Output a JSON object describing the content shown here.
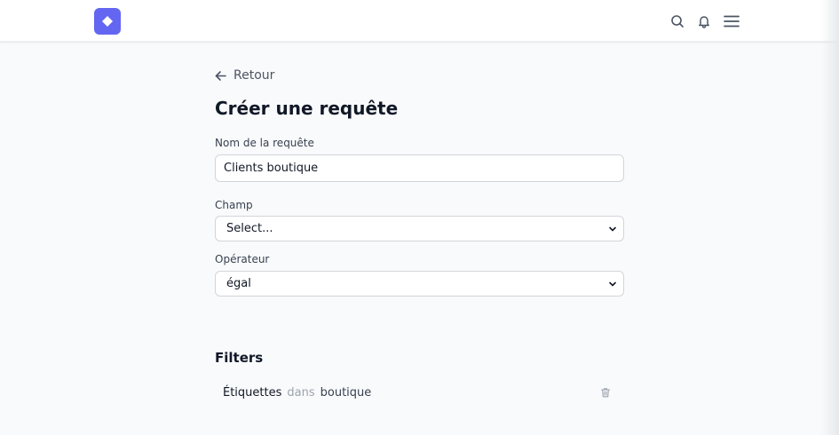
{
  "header": {
    "icons": [
      "logo-icon",
      "search-icon",
      "bell-icon",
      "menu-icon"
    ],
    "accent_color": "#6366f1"
  },
  "nav": {
    "back_label": "Retour"
  },
  "page": {
    "title": "Créer une requête"
  },
  "form": {
    "name_label": "Nom de la requête",
    "name_value": "Clients boutique",
    "field_label": "Champ",
    "field_value": "Select...",
    "operator_label": "Opérateur",
    "operator_value": "égal"
  },
  "filters": {
    "title": "Filters",
    "items": [
      {
        "field": "Étiquettes",
        "operator": "dans",
        "value": "boutique"
      }
    ]
  }
}
